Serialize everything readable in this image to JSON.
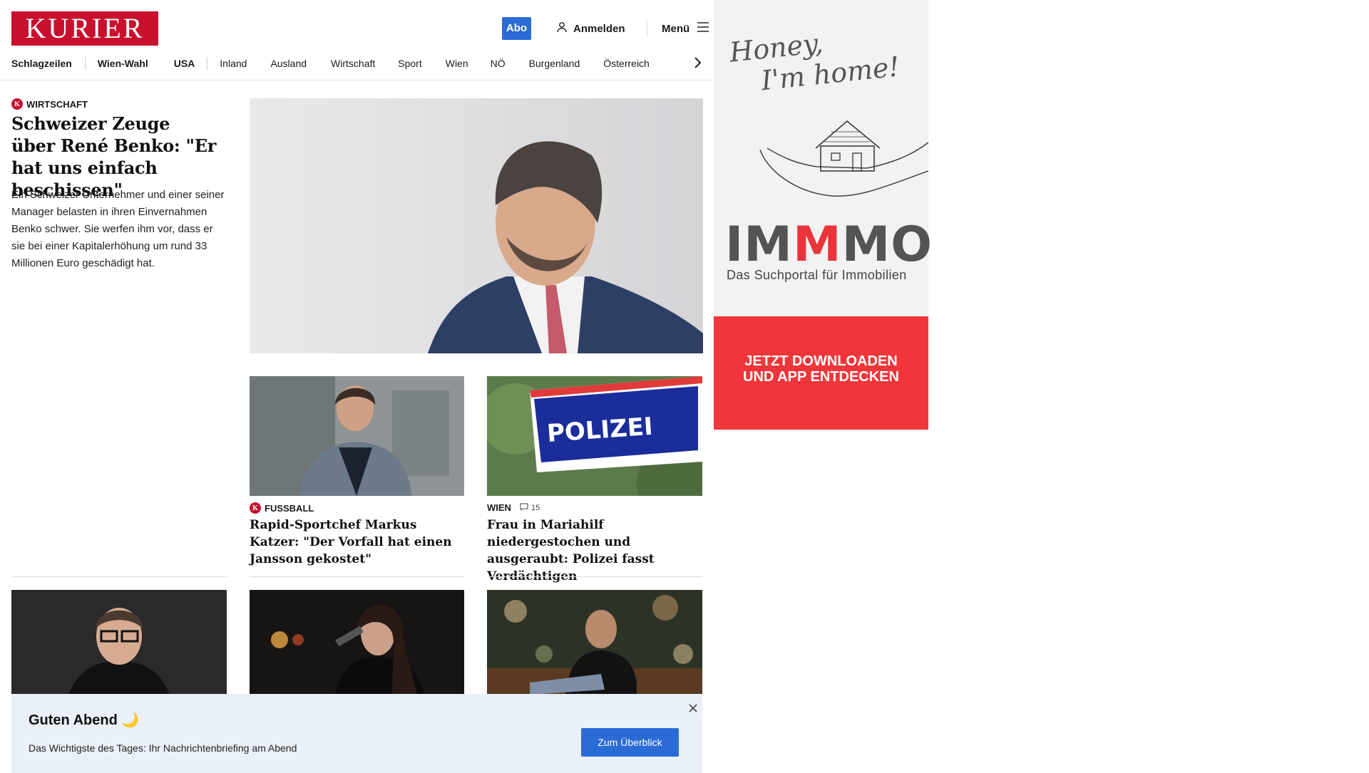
{
  "header": {
    "logo": "KURIER",
    "abo_label": "Abo",
    "login_label": "Anmelden",
    "menu_label": "Menü"
  },
  "nav": {
    "items": [
      "Schlagzeilen",
      "Wien-Wahl",
      "USA",
      "Inland",
      "Ausland",
      "Wirtschaft",
      "Sport",
      "Wien",
      "NÖ",
      "Burgenland",
      "Österreich"
    ]
  },
  "lead": {
    "kicker": "Wirtschaft",
    "title": "Schweizer Zeuge über René Benko: \"Er hat uns einfach beschissen\"",
    "teaser": "Ein Schweizer Unternehmer und einer seiner Manager belasten in ihren Einvernahmen Benko schwer. Sie werfen ihm vor, dass er sie bei einer Kapitalerhöhung um rund 33 Millionen Euro geschädigt hat."
  },
  "cards": [
    {
      "kicker": "Fussball",
      "title": "Rapid-Sportchef Markus Katzer: \"Der Vorfall hat einen Jansson gekostet\""
    },
    {
      "kicker": "Wien",
      "comments": "15",
      "title": "Frau in Mariahilf niedergestochen und ausgeraubt: Polizei fasst Verdächtigen",
      "image_sign": "POLIZEI"
    }
  ],
  "briefing": {
    "title": "Guten Abend 🌙",
    "text": "Das Wichtigste des Tages: Ihr Nachrichtenbriefing am Abend",
    "button": "Zum Überblick"
  },
  "ad": {
    "tagline_line1": "Honey,",
    "tagline_line2": "I'm home!",
    "brand_part1": "IM",
    "brand_part2": "M",
    "brand_part3": "MO",
    "subtitle": "Das Suchportal für Immobilien",
    "cta_line1": "JETZT DOWNLOADEN",
    "cta_line2": "UND APP ENTDECKEN"
  },
  "colors": {
    "brand_red": "#c8102e",
    "accent_blue": "#2b6bd6",
    "briefing_bg": "#eaf0f7",
    "ad_red": "#f0363a"
  }
}
